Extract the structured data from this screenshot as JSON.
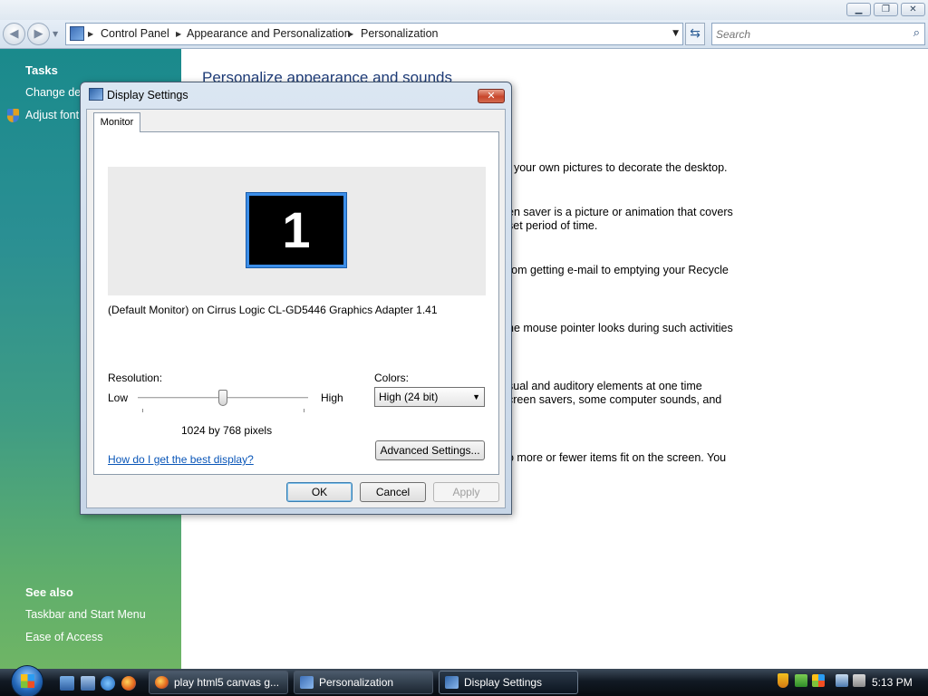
{
  "window": {
    "caption_buttons": [
      "▁",
      "❐",
      "✕"
    ]
  },
  "address_bar": {
    "breadcrumbs": [
      "Control Panel",
      "Appearance and Personalization",
      "Personalization"
    ],
    "search_placeholder": "Search"
  },
  "task_pane": {
    "tasks_heading": "Tasks",
    "tasks": [
      "Change des",
      "Adjust font"
    ],
    "see_also_heading": "See also",
    "see_also": [
      "Taskbar and Start Menu",
      "Ease of Access"
    ]
  },
  "content": {
    "title": "Personalize appearance and sounds",
    "descriptions": [
      [
        "f your own pictures to decorate the desktop."
      ],
      [
        "en saver is a picture or animation that covers",
        "set period of time."
      ],
      [
        "rom getting e-mail to emptying your Recycle"
      ],
      [
        "he mouse pointer looks during such activities"
      ],
      [
        "sual and auditory elements at one time",
        "creen savers, some computer sounds, and"
      ],
      [
        "o more or fewer items fit on the screen. You"
      ]
    ]
  },
  "dialog": {
    "title": "Display Settings",
    "close_label": "✕",
    "tab": "Monitor",
    "monitor_number": "1",
    "monitor_description": "(Default Monitor) on Cirrus Logic CL-GD5446 Graphics Adapter 1.41",
    "resolution_label": "Resolution:",
    "low_label": "Low",
    "high_label": "High",
    "resolution_value": "1024 by 768 pixels",
    "resolution_slider_fraction": 0.5,
    "colors_label": "Colors:",
    "colors_value": "High (24 bit)",
    "help_link": "How do I get the best display?",
    "advanced_button": "Advanced Settings...",
    "ok_button": "OK",
    "cancel_button": "Cancel",
    "apply_button": "Apply"
  },
  "taskbar": {
    "tasks": [
      "play html5 canvas g...",
      "Personalization",
      "Display Settings"
    ],
    "clock": "5:13 PM"
  },
  "colors": {
    "task_pane_top": "#1a8a8c",
    "task_pane_bottom": "#6fb565",
    "link_blue": "#0a56b8",
    "content_title": "#1e3c78",
    "monitor_highlight": "#3c8ee8"
  }
}
